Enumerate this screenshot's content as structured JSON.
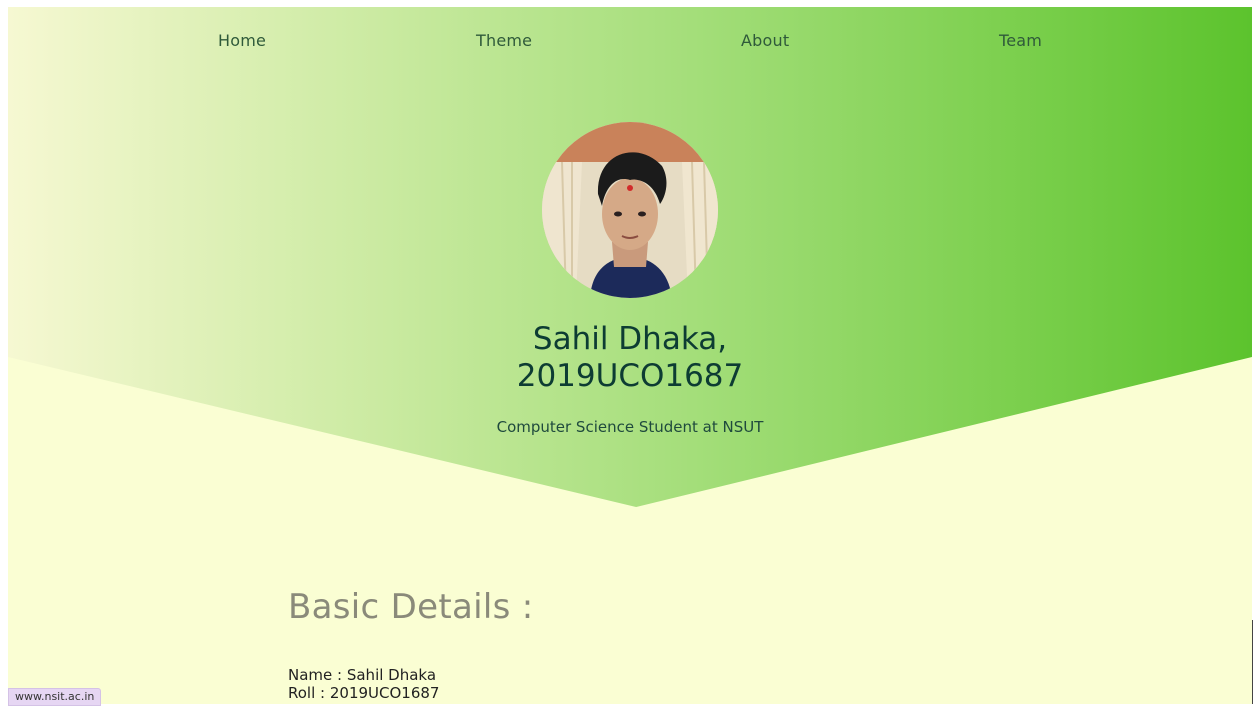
{
  "nav": {
    "items": [
      {
        "label": "Home"
      },
      {
        "label": "Theme"
      },
      {
        "label": "About"
      },
      {
        "label": "Team"
      }
    ]
  },
  "profile": {
    "name_line1": "Sahil Dhaka,",
    "name_line2": "2019UCO1687",
    "subtitle": "Computer Science Student at NSUT",
    "avatar_icon": "profile-photo"
  },
  "basic_details": {
    "title": "Basic Details :",
    "name": "Name : Sahil Dhaka",
    "roll": "Roll : 2019UCO1687"
  },
  "status_bar": {
    "url": "www.nsit.ac.in"
  },
  "colors": {
    "background": "#fafed3",
    "gradient_start": "#f6f8d2",
    "gradient_end": "#5cc32d",
    "text_dark": "#0d3c33"
  }
}
